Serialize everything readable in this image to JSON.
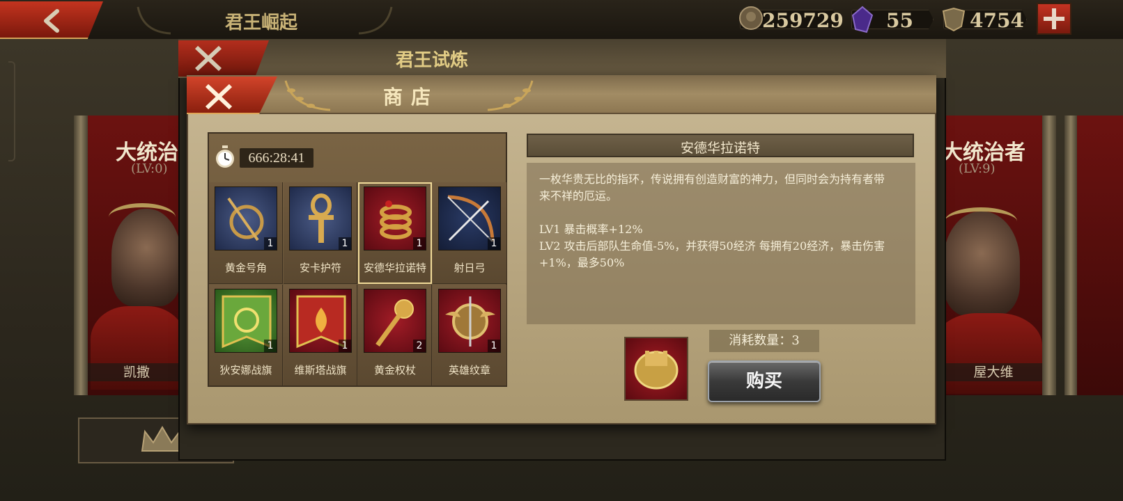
{
  "top_bar": {
    "title": "君王崛起",
    "resources": [
      {
        "icon": "gold-coin-icon",
        "value": "259729"
      },
      {
        "icon": "purple-gem-icon",
        "value": "55"
      },
      {
        "icon": "crest-token-icon",
        "value": "4754"
      }
    ]
  },
  "background": {
    "left_banner": {
      "title": "大统治",
      "level": "(LV:0)",
      "hero_name": "凯撒"
    },
    "right_banner": {
      "title": "大统治者",
      "level": "(LV:9)",
      "hero_name": "屋大维"
    }
  },
  "trial_window": {
    "title": "君王试炼"
  },
  "shop": {
    "title": "商店",
    "timer": "666:28:41",
    "items": [
      {
        "label": "黄金号角",
        "qty": "1",
        "icon": "golden-horn-icon"
      },
      {
        "label": "安卡护符",
        "qty": "1",
        "icon": "ankh-amulet-icon"
      },
      {
        "label": "安德华拉诺特",
        "qty": "1",
        "icon": "serpent-ring-icon"
      },
      {
        "label": "射日弓",
        "qty": "1",
        "icon": "sun-bow-icon"
      },
      {
        "label": "狄安娜战旗",
        "qty": "1",
        "icon": "diana-banner-icon"
      },
      {
        "label": "维斯塔战旗",
        "qty": "1",
        "icon": "vesta-banner-icon"
      },
      {
        "label": "黄金权杖",
        "qty": "2",
        "icon": "golden-scepter-icon"
      },
      {
        "label": "英雄纹章",
        "qty": "1",
        "icon": "hero-emblem-icon"
      }
    ],
    "detail": {
      "name": "安德华拉诺特",
      "description_lines": [
        "一枚华贵无比的指环，传说拥有创造财富的神力，但同时会为持有者带",
        "来不祥的厄运。",
        "LV1 暴击概率+12%",
        "LV2 攻击后部队生命值-5%，并获得50经济  每拥有20经济，暴击伤害",
        "+1%，最多50%"
      ],
      "cost_label": "消耗数量：3",
      "cost_icon": "tower-crest-icon",
      "buy_label": "购买"
    }
  },
  "colors": {
    "accent_red": "#c4341f",
    "gold_text": "#e3cd86",
    "parchment": "#b7a57f"
  }
}
